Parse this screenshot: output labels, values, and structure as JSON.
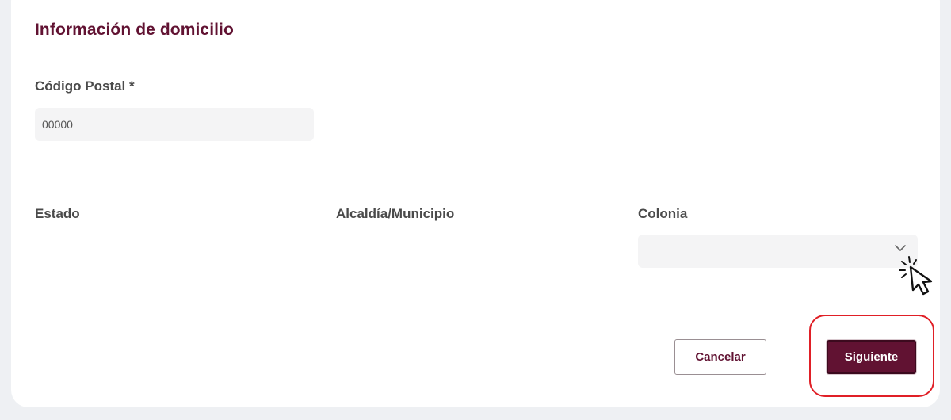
{
  "section": {
    "title": "Información de domicilio"
  },
  "fields": {
    "codigo_postal": {
      "label": "Código Postal *",
      "placeholder": "00000",
      "value": ""
    },
    "estado": {
      "label": "Estado"
    },
    "alcaldia": {
      "label": "Alcaldía/Municipio"
    },
    "colonia": {
      "label": "Colonia",
      "selected": ""
    }
  },
  "actions": {
    "cancel_label": "Cancelar",
    "next_label": "Siguiente"
  },
  "colors": {
    "accent": "#611232",
    "highlight": "#e01f26"
  },
  "icons": {
    "dropdown": "chevron-down-icon",
    "pointer": "click-cursor-icon"
  }
}
